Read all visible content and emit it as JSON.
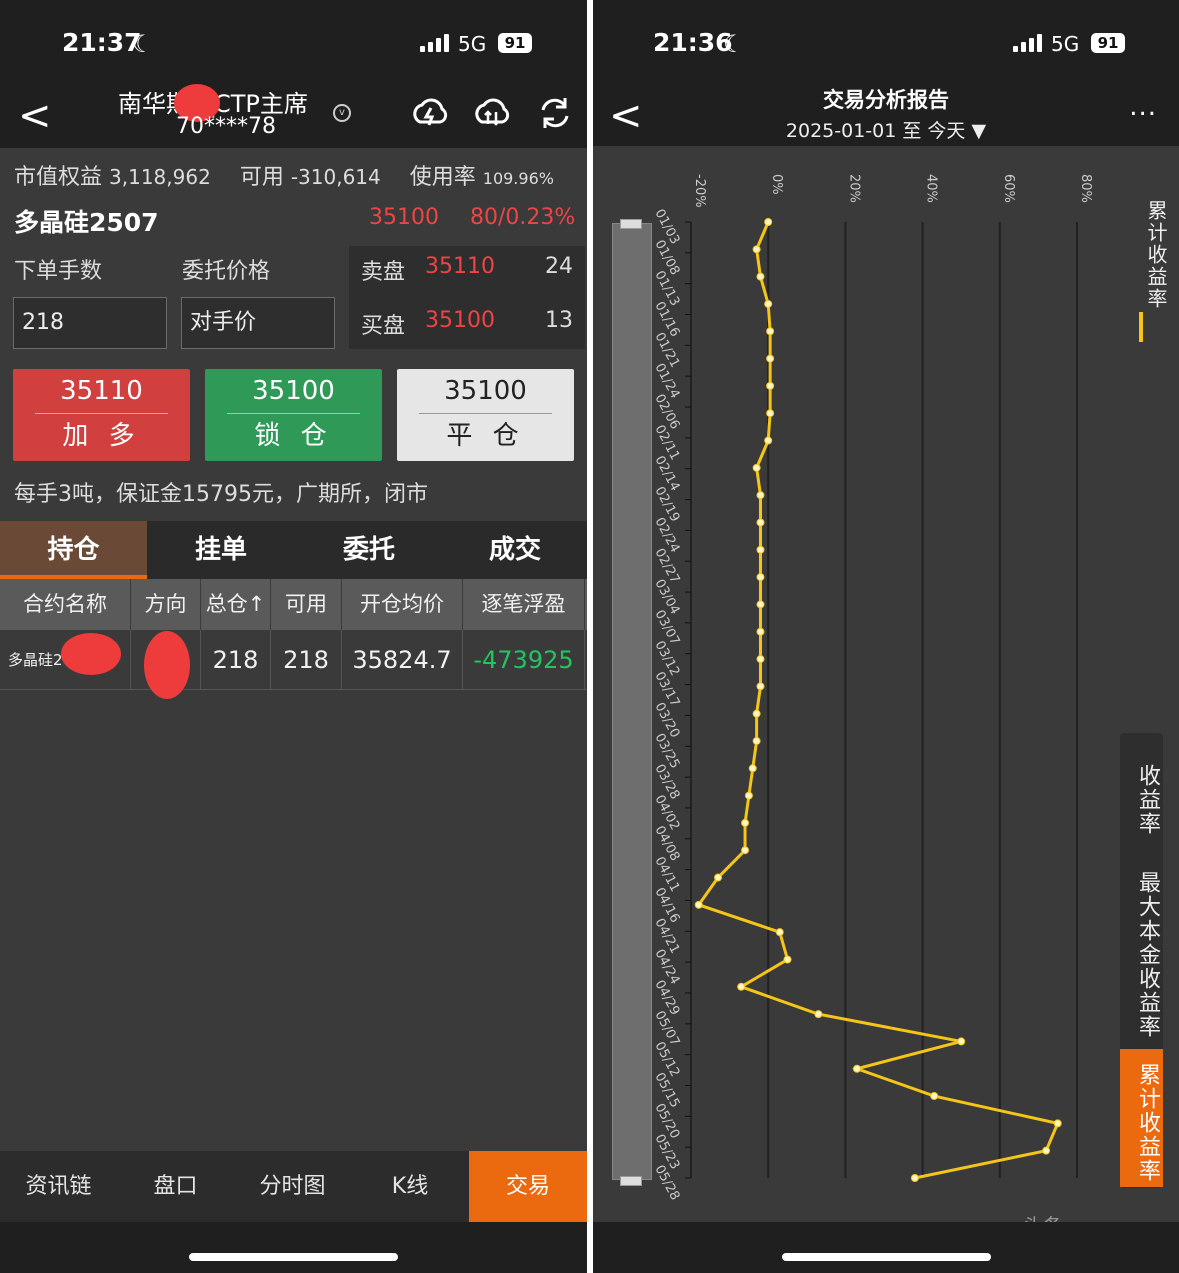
{
  "left": {
    "status": {
      "time": "21:37",
      "network": "5G",
      "battery": "91"
    },
    "header": {
      "title": "南华期__CTP主席",
      "account": "70****78"
    },
    "account_bar": {
      "equity_label": "市值权益",
      "equity": "3,118,962",
      "available_label": "可用",
      "available": "-310,614",
      "usage_label": "使用率",
      "usage": "109.96%"
    },
    "contract": {
      "name": "多晶硅2507",
      "last_price": "35100",
      "change": "80/0.23%"
    },
    "order": {
      "qty_label": "下单手数",
      "price_label": "委托价格",
      "qty_value": "218",
      "price_value": "对手价"
    },
    "book": {
      "ask_label": "卖盘",
      "ask_price": "35110",
      "ask_volume": "24",
      "bid_label": "买盘",
      "bid_price": "35100",
      "bid_volume": "13"
    },
    "buttons": [
      {
        "price": "35110",
        "label": "加 多",
        "color": "#d23f3f"
      },
      {
        "price": "35100",
        "label": "锁 仓",
        "color": "#2f9a58"
      },
      {
        "price": "35100",
        "label": "平 仓",
        "color": "#e6e6e6"
      }
    ],
    "info": "每手3吨，保证金15795元，广期所，闭市",
    "tabs": [
      "持仓",
      "挂单",
      "委托",
      "成交"
    ],
    "table": {
      "headers": [
        "合约名称",
        "方向",
        "总仓↑",
        "可用",
        "开仓均价",
        "逐笔浮盈"
      ],
      "rows": [
        {
          "name": "多晶硅2",
          "direction": "",
          "total": "218",
          "available": "218",
          "avg_price": "35824.7",
          "pnl": "-473925"
        }
      ]
    },
    "bottom_nav": [
      "资讯链",
      "盘口",
      "分时图",
      "K线",
      "交易"
    ],
    "colors": {
      "accent": "#ec6a0f",
      "up": "#ef4444",
      "down": "#22c55e"
    }
  },
  "right": {
    "status": {
      "time": "21:36",
      "network": "5G",
      "battery": "91"
    },
    "header": {
      "title": "交易分析报告",
      "range": "2025-01-01 至 今天",
      "more": "..."
    },
    "side_tabs": [
      "收益率",
      "最大本金收益率",
      "累计收益率"
    ],
    "legend": "累计收益率",
    "watermark": "头条"
  },
  "chart_data": {
    "type": "line",
    "orientation": "horizontal-value-axis, vertical-date-axis",
    "x_ticks": [
      "-20%",
      "0%",
      "20%",
      "40%",
      "60%",
      "80%"
    ],
    "xlim": [
      -20,
      80
    ],
    "y_tick_labels": [
      "01/03",
      "01/08",
      "01/13",
      "01/16",
      "01/21",
      "01/24",
      "02/06",
      "02/11",
      "02/14",
      "02/19",
      "02/24",
      "02/27",
      "03/04",
      "03/07",
      "03/12",
      "03/17",
      "03/20",
      "03/25",
      "03/28",
      "04/02",
      "04/08",
      "04/11",
      "04/16",
      "04/21",
      "04/24",
      "04/29",
      "05/07",
      "05/12",
      "05/15",
      "05/20",
      "05/23",
      "05/28"
    ],
    "series": [
      {
        "name": "累计收益率",
        "color": "#f5c518",
        "values": [
          0,
          -3,
          -2,
          0,
          0.5,
          0.5,
          0.5,
          0.5,
          0,
          -3,
          -2,
          -2,
          -2,
          -2,
          -2,
          -2,
          -2,
          -2,
          -3,
          -3,
          -4,
          -5,
          -6,
          -6,
          -13,
          -18,
          3,
          5,
          -7,
          13,
          50,
          23,
          43,
          75,
          72,
          38
        ]
      }
    ],
    "grid": true
  }
}
